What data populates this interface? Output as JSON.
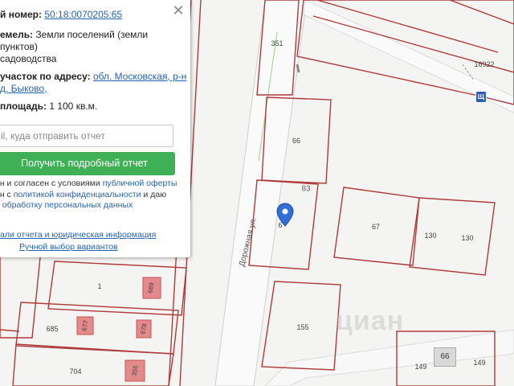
{
  "panel": {
    "cadastral_label": "й номер:",
    "cadastral_number": "50:18:0070205:65",
    "category_label": "емель:",
    "category_value_1": "Земли поселений (земли",
    "category_value_2": "пунктов)",
    "use_value": "садоводства",
    "address_label": "участок по адресу:",
    "address_link_1": "обл. Московская, р-н",
    "address_link_2": "д. Быково,",
    "area_label": "площадь:",
    "area_value": "1 100 кв.м.",
    "email_placeholder": "il, куда отправить отчет",
    "report_button": "Получить подробный отчет",
    "agree_1_text": "ен и согласен с условиями ",
    "agree_1_link": "публичной оферты",
    "agree_2_text": "ен с ",
    "agree_2_link": "политикой конфиденциальности",
    "agree_2_tail": " и даю",
    "agree_3_link": "а обработку персональных данных",
    "sample_link": "али отчета и юридическая информация",
    "manual_link": "Ручной выбор вариантов",
    "close_icon": "close-icon"
  },
  "map": {
    "street_label": "Дорожная ул.",
    "route_badge": "Щ",
    "watermark": "циан",
    "pin_label": "6",
    "plots": {
      "p351": "351",
      "p16922": "16922",
      "p66a": "66",
      "p83": "83",
      "p67": "67",
      "p130a": "130",
      "p130b": "130",
      "p155": "155",
      "p1": "1",
      "p685": "685",
      "p704": "704",
      "p149a": "149",
      "p149b": "149",
      "p66b": "66",
      "b689": "689",
      "b677": "677",
      "b678": "678",
      "b355": "355"
    }
  },
  "colors": {
    "plot_border": "#b03a3a",
    "accent_green": "#3fb055",
    "link_blue": "#2563b5",
    "pin_blue": "#2f6fd6"
  }
}
